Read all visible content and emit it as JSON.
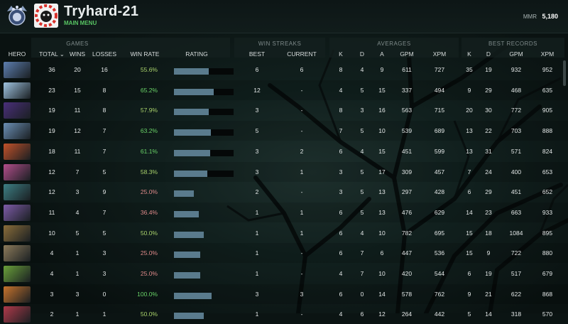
{
  "player": {
    "name": "Tryhard-21",
    "menu_link": "MAIN MENU",
    "mmr_label": "MMR",
    "mmr_value": "5,180"
  },
  "groups": {
    "games": "GAMES",
    "win_streaks": "WIN STREAKS",
    "averages": "AVERAGES",
    "best_records": "BEST RECORDS"
  },
  "columns": {
    "hero": "HERO",
    "total": "TOTAL ⌄",
    "wins": "WINS",
    "losses": "LOSSES",
    "win_rate": "WIN RATE",
    "rating": "RATING",
    "best": "BEST",
    "current": "CURRENT",
    "k": "K",
    "d": "D",
    "a": "A",
    "gpm": "GPM",
    "xpm": "XPM",
    "rk": "K",
    "rd": "D",
    "rgpm": "GPM",
    "rxpm": "XPM"
  },
  "colors": {
    "win_good": "#6ad468",
    "win_mid": "#a9d26b",
    "win_bad": "#e08a8a",
    "bar": "#5a7b8d"
  },
  "rows": [
    {
      "hero_icon": "hero-icon-1",
      "portrait": "#5d7fb0",
      "total": "36",
      "wins": "20",
      "losses": "16",
      "win_rate": "55.6%",
      "rating": 0.58,
      "rating_track": true,
      "best": "6",
      "current": "6",
      "k": "8",
      "d": "4",
      "a": "9",
      "gpm": "611",
      "xpm": "727",
      "bk": "35",
      "bd": "19",
      "bgpm": "932",
      "bxpm": "952"
    },
    {
      "hero_icon": "hero-icon-2",
      "portrait": "#9fc3e0",
      "total": "23",
      "wins": "15",
      "losses": "8",
      "win_rate": "65.2%",
      "rating": 0.67,
      "rating_track": true,
      "best": "12",
      "current": "-",
      "k": "4",
      "d": "5",
      "a": "15",
      "gpm": "337",
      "xpm": "494",
      "bk": "9",
      "bd": "29",
      "bgpm": "468",
      "bxpm": "635"
    },
    {
      "hero_icon": "hero-icon-3",
      "portrait": "#4a2f7a",
      "total": "19",
      "wins": "11",
      "losses": "8",
      "win_rate": "57.9%",
      "rating": 0.58,
      "rating_track": true,
      "best": "3",
      "current": "-",
      "k": "8",
      "d": "3",
      "a": "16",
      "gpm": "563",
      "xpm": "715",
      "bk": "20",
      "bd": "30",
      "bgpm": "772",
      "bxpm": "905"
    },
    {
      "hero_icon": "hero-icon-4",
      "portrait": "#6b8fb5",
      "total": "19",
      "wins": "12",
      "losses": "7",
      "win_rate": "63.2%",
      "rating": 0.62,
      "rating_track": true,
      "best": "5",
      "current": "-",
      "k": "7",
      "d": "5",
      "a": "10",
      "gpm": "539",
      "xpm": "689",
      "bk": "13",
      "bd": "22",
      "bgpm": "703",
      "bxpm": "888"
    },
    {
      "hero_icon": "hero-icon-5",
      "portrait": "#c2522a",
      "total": "18",
      "wins": "11",
      "losses": "7",
      "win_rate": "61.1%",
      "rating": 0.61,
      "rating_track": true,
      "best": "3",
      "current": "2",
      "k": "6",
      "d": "4",
      "a": "15",
      "gpm": "451",
      "xpm": "599",
      "bk": "13",
      "bd": "31",
      "bgpm": "571",
      "bxpm": "824"
    },
    {
      "hero_icon": "hero-icon-6",
      "portrait": "#b24e8b",
      "total": "12",
      "wins": "7",
      "losses": "5",
      "win_rate": "58.3%",
      "rating": 0.56,
      "rating_track": true,
      "best": "3",
      "current": "1",
      "k": "3",
      "d": "5",
      "a": "17",
      "gpm": "309",
      "xpm": "457",
      "bk": "7",
      "bd": "24",
      "bgpm": "400",
      "bxpm": "653"
    },
    {
      "hero_icon": "hero-icon-7",
      "portrait": "#3d7f84",
      "total": "12",
      "wins": "3",
      "losses": "9",
      "win_rate": "25.0%",
      "rating": 0.33,
      "rating_track": false,
      "best": "2",
      "current": "-",
      "k": "3",
      "d": "5",
      "a": "13",
      "gpm": "297",
      "xpm": "428",
      "bk": "6",
      "bd": "29",
      "bgpm": "451",
      "bxpm": "652"
    },
    {
      "hero_icon": "hero-icon-8",
      "portrait": "#7e5ca8",
      "total": "11",
      "wins": "4",
      "losses": "7",
      "win_rate": "36.4%",
      "rating": 0.42,
      "rating_track": false,
      "best": "1",
      "current": "1",
      "k": "6",
      "d": "5",
      "a": "13",
      "gpm": "476",
      "xpm": "629",
      "bk": "14",
      "bd": "23",
      "bgpm": "663",
      "bxpm": "933"
    },
    {
      "hero_icon": "hero-icon-9",
      "portrait": "#8a6d3a",
      "total": "10",
      "wins": "5",
      "losses": "5",
      "win_rate": "50.0%",
      "rating": 0.5,
      "rating_track": false,
      "best": "1",
      "current": "1",
      "k": "6",
      "d": "4",
      "a": "10",
      "gpm": "782",
      "xpm": "695",
      "bk": "15",
      "bd": "18",
      "bgpm": "1084",
      "bxpm": "895"
    },
    {
      "hero_icon": "hero-icon-10",
      "portrait": "#8c7b5a",
      "total": "4",
      "wins": "1",
      "losses": "3",
      "win_rate": "25.0%",
      "rating": 0.44,
      "rating_track": false,
      "best": "1",
      "current": "-",
      "k": "6",
      "d": "7",
      "a": "6",
      "gpm": "447",
      "xpm": "536",
      "bk": "15",
      "bd": "9",
      "bgpm": "722",
      "bxpm": "880"
    },
    {
      "hero_icon": "hero-icon-11",
      "portrait": "#6aa13a",
      "total": "4",
      "wins": "1",
      "losses": "3",
      "win_rate": "25.0%",
      "rating": 0.44,
      "rating_track": false,
      "best": "1",
      "current": "-",
      "k": "4",
      "d": "7",
      "a": "10",
      "gpm": "420",
      "xpm": "544",
      "bk": "6",
      "bd": "19",
      "bgpm": "517",
      "bxpm": "679"
    },
    {
      "hero_icon": "hero-icon-12",
      "portrait": "#c7732d",
      "total": "3",
      "wins": "3",
      "losses": "0",
      "win_rate": "100.0%",
      "rating": 0.63,
      "rating_track": false,
      "best": "3",
      "current": "3",
      "k": "6",
      "d": "0",
      "a": "14",
      "gpm": "578",
      "xpm": "762",
      "bk": "9",
      "bd": "21",
      "bgpm": "622",
      "bxpm": "868"
    },
    {
      "hero_icon": "hero-icon-13",
      "portrait": "#b03a4a",
      "total": "2",
      "wins": "1",
      "losses": "1",
      "win_rate": "50.0%",
      "rating": 0.5,
      "rating_track": false,
      "best": "1",
      "current": "-",
      "k": "4",
      "d": "6",
      "a": "12",
      "gpm": "264",
      "xpm": "442",
      "bk": "5",
      "bd": "14",
      "bgpm": "318",
      "bxpm": "570"
    }
  ]
}
